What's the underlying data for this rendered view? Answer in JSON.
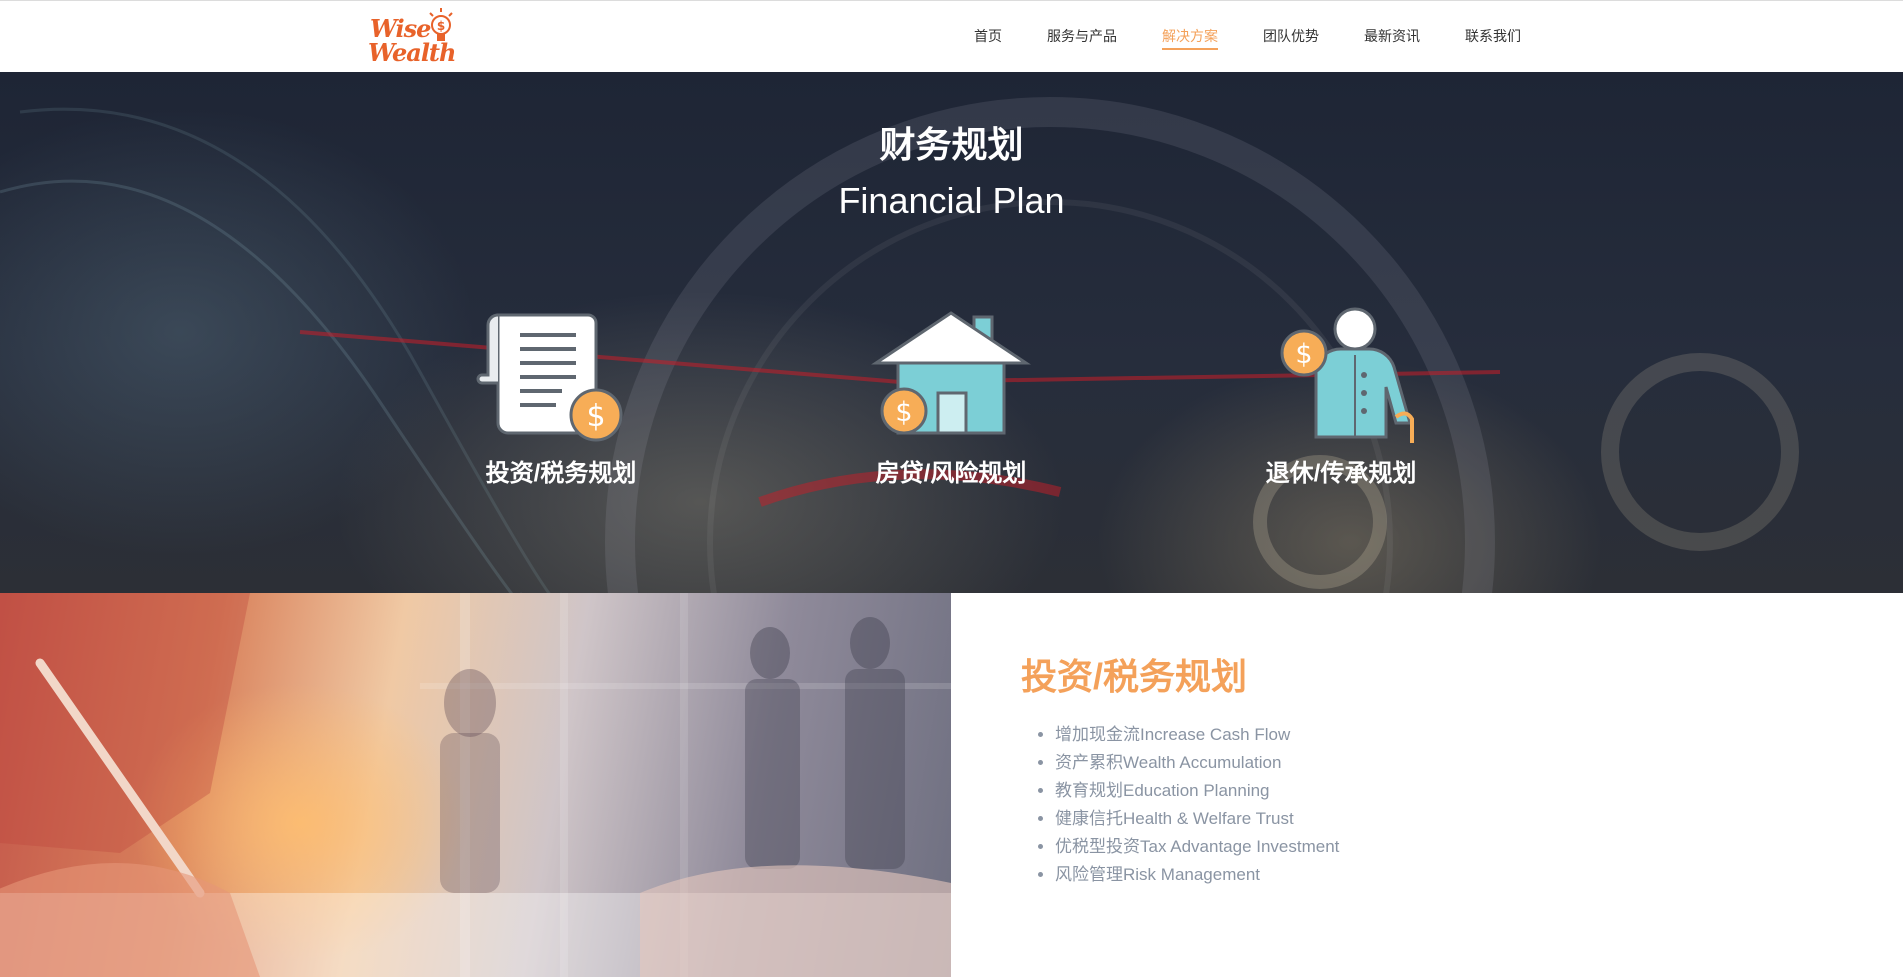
{
  "brand": {
    "logo_line1": "Wise",
    "logo_line2": "Wealth"
  },
  "nav": {
    "items": [
      {
        "label": "首页"
      },
      {
        "label": "服务与产品"
      },
      {
        "label": "解决方案"
      },
      {
        "label": "团队优势"
      },
      {
        "label": "最新资讯"
      },
      {
        "label": "联系我们"
      }
    ],
    "active_index": 2
  },
  "hero": {
    "title_cn": "财务规划",
    "title_en": "Financial Plan",
    "features": [
      {
        "label": "投资/税务规划",
        "icon": "document-dollar-icon"
      },
      {
        "label": "房贷/风险规划",
        "icon": "house-dollar-icon"
      },
      {
        "label": "退休/传承规划",
        "icon": "elderly-dollar-icon"
      }
    ]
  },
  "detail": {
    "heading": "投资/税务规划",
    "items": [
      "增加现金流Increase Cash Flow",
      "资产累积Wealth Accumulation",
      "教育规划Education Planning",
      "健康信托Health & Welfare Trust",
      "优税型投资Tax Advantage Investment",
      "风险管理Risk Management"
    ]
  },
  "colors": {
    "accent_orange": "#f4a15a",
    "logo_orange": "#e8622a",
    "icon_teal": "#7ccfd6",
    "icon_coin": "#f7ad57",
    "hero_dark": "#1e2535",
    "list_text": "#8a94a3"
  }
}
